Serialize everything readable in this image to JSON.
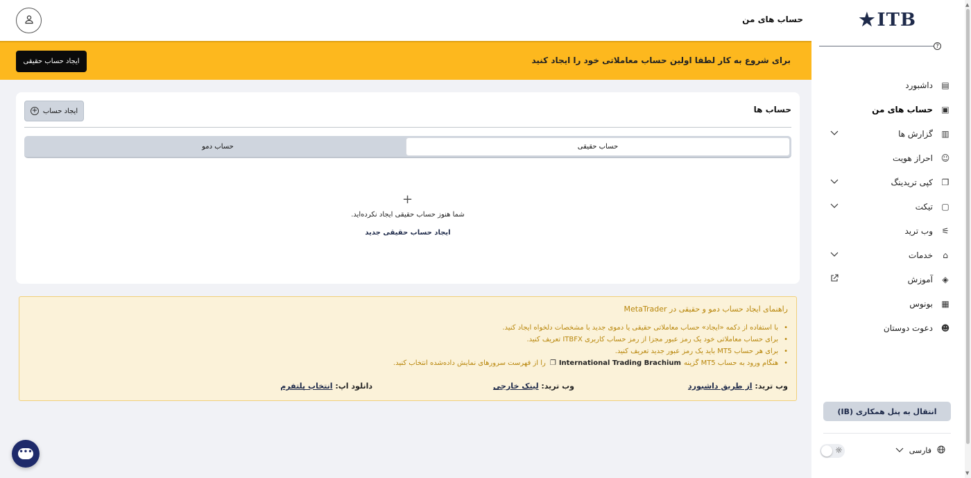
{
  "brand": {
    "logo_text": "ITB",
    "logo_star": "★"
  },
  "header": {
    "title": "حساب های من"
  },
  "banner": {
    "text": "برای شروع به کار لطفا اولین حساب معاملاتی خود را ایجاد کنید",
    "button_label": "ایجاد حساب حقیقی",
    "color": "#fdb81e"
  },
  "sidebar": {
    "items": [
      {
        "label": "داشبورد",
        "icon": "chart-icon",
        "glyph": "▤",
        "chevron": false,
        "active": false
      },
      {
        "label": "حساب های من",
        "icon": "wallet-icon",
        "glyph": "▣",
        "chevron": false,
        "active": true
      },
      {
        "label": "گزارش ها",
        "icon": "bar-chart-icon",
        "glyph": "▥",
        "chevron": true,
        "active": false
      },
      {
        "label": "احراز هویت",
        "icon": "face-scan-icon",
        "glyph": "☺",
        "chevron": false,
        "active": false
      },
      {
        "label": "کپی تریدینگ",
        "icon": "copy-icon",
        "glyph": "❐",
        "chevron": true,
        "active": false
      },
      {
        "label": "تیکت",
        "icon": "ticket-icon",
        "glyph": "▢",
        "chevron": true,
        "active": false
      },
      {
        "label": "وب ترید",
        "icon": "sliders-icon",
        "glyph": "⚟",
        "chevron": false,
        "active": false
      },
      {
        "label": "خدمات",
        "icon": "home-icon",
        "glyph": "⌂",
        "chevron": true,
        "active": false
      },
      {
        "label": "آموزش",
        "icon": "graduation-cap-icon",
        "glyph": "◈",
        "chevron": false,
        "active": false,
        "external": true
      },
      {
        "label": "بونوس",
        "icon": "gift-icon",
        "glyph": "▦",
        "chevron": false,
        "active": false
      },
      {
        "label": "دعوت دوستان",
        "icon": "add-user-icon",
        "glyph": "☻",
        "chevron": false,
        "active": false
      }
    ],
    "ib_button": "انتقال به پنل همکاری (IB)",
    "language": "فارسی"
  },
  "accounts": {
    "title": "حساب ها",
    "add_button": "ایجاد حساب",
    "tabs": [
      {
        "label": "حساب حقیقی",
        "active": true
      },
      {
        "label": "حساب دمو",
        "active": false
      }
    ],
    "empty_text": "شما هنوز حساب حقیقی ایجاد نکرده‌اید.",
    "empty_link": "ایجاد حساب حقیقی جدید"
  },
  "guide": {
    "title": "راهنمای ایجاد حساب دمو و حقیقی در MetaTrader",
    "items": [
      {
        "text": "با استفاده از دکمه «ایجاد» حساب معاملاتی حقیقی یا دموی جدید با مشخصات دلخواه ایجاد کنید."
      },
      {
        "text": "برای حساب معاملاتی خود یک رمز عبور مجزا از رمز حساب کاربری ITBFX تعریف کنید."
      },
      {
        "text": "برای هر حساب MT5 باید یک رمز عبور جدید تعریف کنید."
      },
      {
        "pre": "هنگام ورود به حساب MT5 گزینه",
        "bold": "International Trading Brachium",
        "post": "را از فهرست سرورهای نمایش داده‌شده انتخاب کنید."
      }
    ],
    "links": [
      {
        "label": "وب ترید:",
        "link": "از طریق داشبورد"
      },
      {
        "label": "وب ترید:",
        "link": "لینک خارجی"
      },
      {
        "label": "دانلود اپ:",
        "link": "انتخاب پلتفرم"
      }
    ]
  }
}
